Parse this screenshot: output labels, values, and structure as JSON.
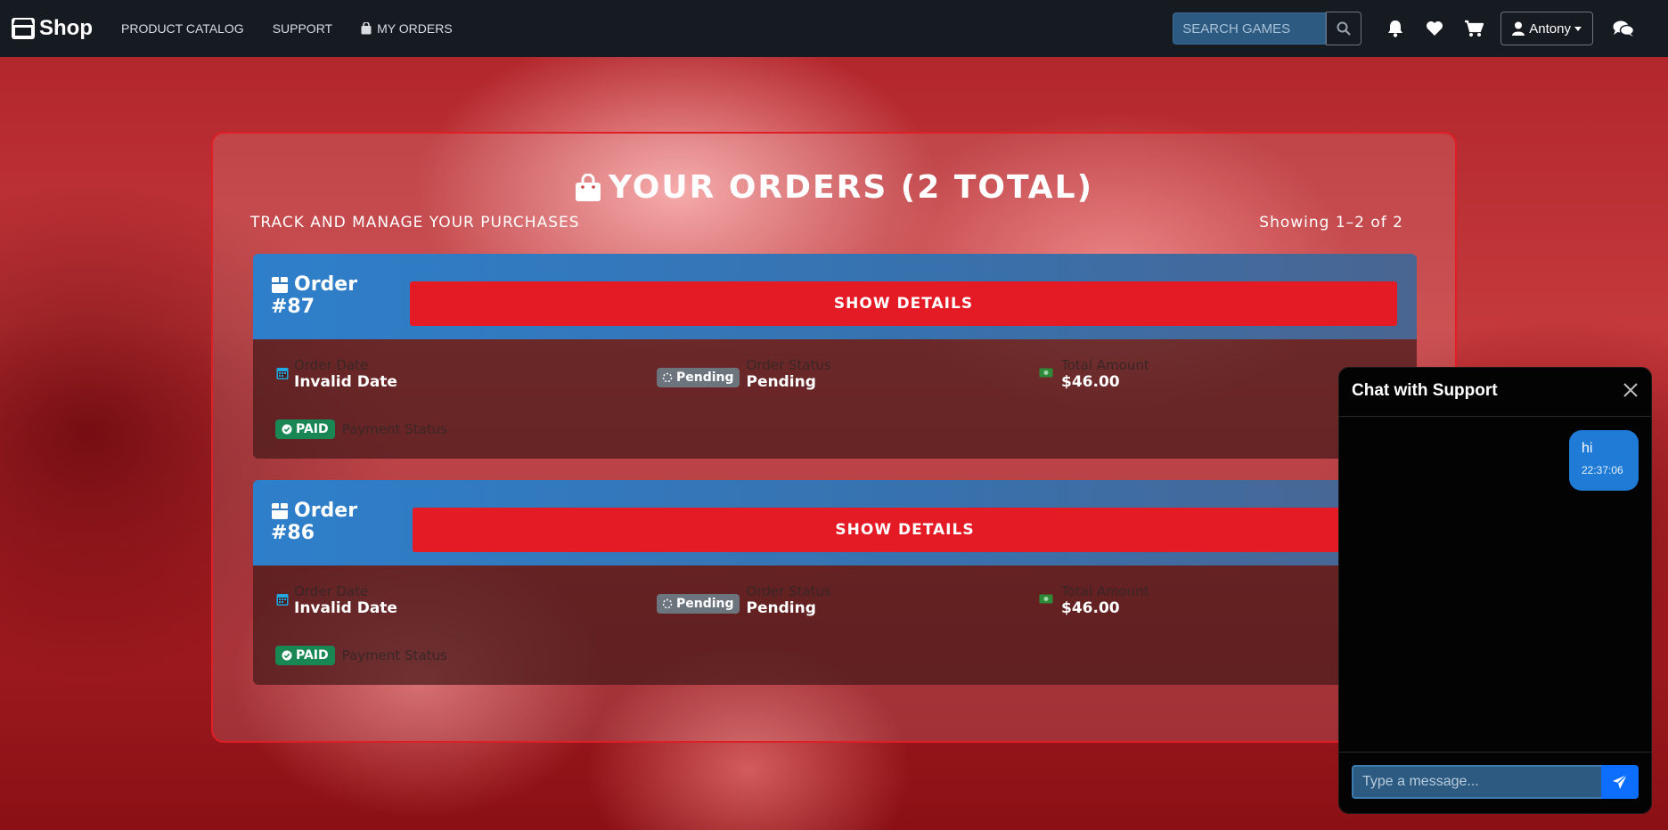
{
  "navbar": {
    "brand": "Shop",
    "links": [
      "PRODUCT CATALOG",
      "SUPPORT",
      "MY ORDERS"
    ],
    "search_placeholder": "SEARCH GAMES",
    "user_name": "Antony"
  },
  "orders": {
    "title": "YOUR ORDERS (2 TOTAL)",
    "subtitle": "TRACK AND MANAGE YOUR PURCHASES",
    "showing": "Showing 1–2 of 2",
    "details_label": "SHOW DETAILS",
    "labels": {
      "order_word": "Order",
      "order_date": "Order Date",
      "order_status": "Order Status",
      "total_amount": "Total Amount",
      "payment_status": "Payment Status"
    },
    "items": [
      {
        "number": "#87",
        "date": "Invalid Date",
        "status_badge": "Pending",
        "status": "Pending",
        "total": "$46.00",
        "payment_badge": "PAID"
      },
      {
        "number": "#86",
        "date": "Invalid Date",
        "status_badge": "Pending",
        "status": "Pending",
        "total": "$46.00",
        "payment_badge": "PAID"
      }
    ]
  },
  "chat": {
    "title": "Chat with Support",
    "messages": [
      {
        "text": "hi",
        "time": "22:37:06"
      }
    ],
    "input_placeholder": "Type a message..."
  },
  "colors": {
    "navbar": "#161b22",
    "accent_red": "#e41b24",
    "header_blue": "#2e7fcb",
    "paid_green": "#198754",
    "pending_gray": "#6c757d",
    "chat_bubble": "#1f7bd6"
  }
}
